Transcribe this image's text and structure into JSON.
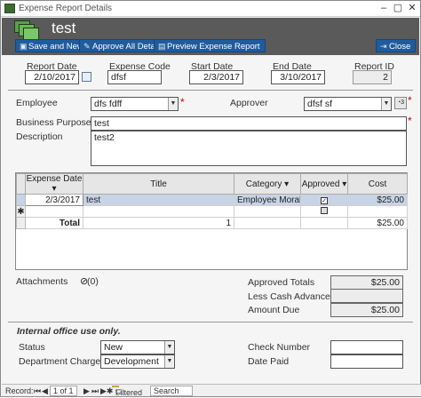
{
  "window": {
    "title": "Expense Report Details"
  },
  "header": {
    "form_title": "test",
    "buttons": {
      "save_new": "Save and New",
      "approve_all": "Approve All Details",
      "preview": "Preview Expense Report",
      "close": "Close"
    }
  },
  "top_fields": {
    "report_date": {
      "label": "Report Date",
      "value": "2/10/2017"
    },
    "expense_code": {
      "label": "Expense Code",
      "value": "dfsf"
    },
    "start_date": {
      "label": "Start Date",
      "value": "2/3/2017"
    },
    "end_date": {
      "label": "End Date",
      "value": "3/10/2017"
    },
    "report_id": {
      "label": "Report ID",
      "value": "2"
    }
  },
  "people": {
    "employee_label": "Employee",
    "employee_value": "dfs fdff",
    "approver_label": "Approver",
    "approver_value": "dfsf sf",
    "required_mark": "*"
  },
  "business_purpose": {
    "label": "Business Purpose",
    "value": "test"
  },
  "description": {
    "label": "Description",
    "value": "test2"
  },
  "details_table": {
    "columns": [
      "Expense Date",
      "Title",
      "Category",
      "Approved",
      "Cost"
    ],
    "rows": [
      {
        "expense_date": "2/3/2017",
        "title": "test",
        "category": "Employee Morale",
        "approved": "✓",
        "cost": "$25.00"
      }
    ],
    "new_row_marker": "✱",
    "total_label": "Total",
    "total_count": "1",
    "total_cost": "$25.00"
  },
  "attachments": {
    "label": "Attachments",
    "count": "(0)"
  },
  "totals": {
    "approved_label": "Approved Totals",
    "approved_value": "$25.00",
    "cash_advance_label": "Less Cash Advance",
    "cash_advance_value": "",
    "amount_due_label": "Amount Due",
    "amount_due_value": "$25.00"
  },
  "office": {
    "heading": "Internal office use only.",
    "status_label": "Status",
    "status_value": "New",
    "dept_label": "Department Charged",
    "dept_value": "Development",
    "check_label": "Check Number",
    "check_value": "",
    "date_paid_label": "Date Paid",
    "date_paid_value": ""
  },
  "statusbar": {
    "record_label": "Record:",
    "record_value": "1 of 1",
    "filter": "Filtered",
    "search": "Search"
  },
  "colors": {
    "header_bg": "#5a5a5a",
    "button_blue": "#1f5c9e",
    "selection": "#c9d3e6"
  }
}
